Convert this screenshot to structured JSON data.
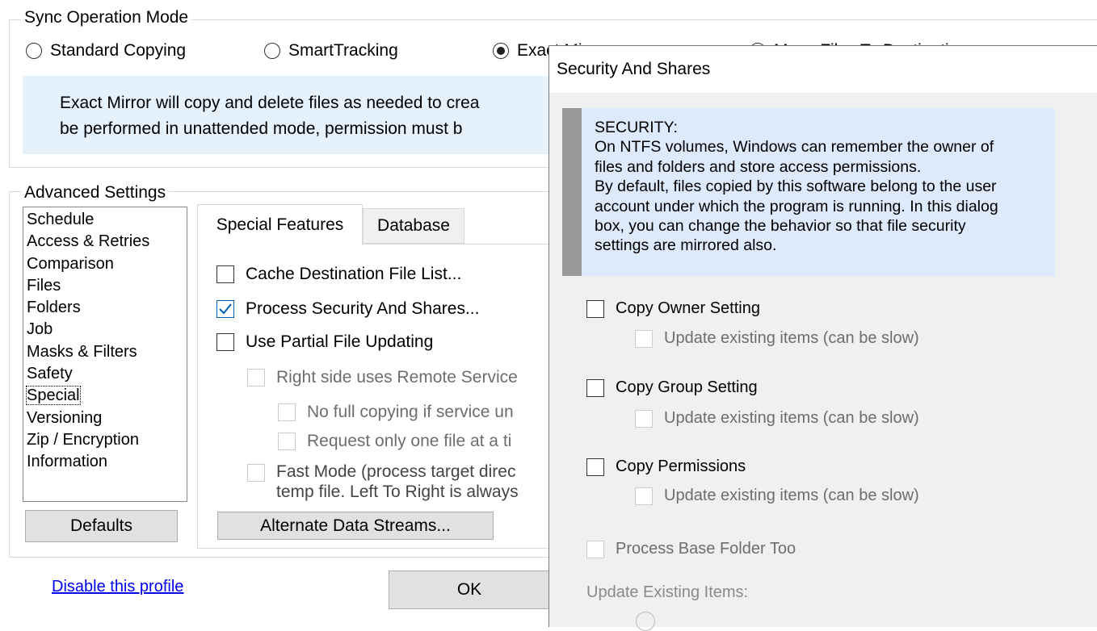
{
  "sync_mode": {
    "title": "Sync Operation Mode",
    "options": [
      {
        "label": "Standard Copying",
        "selected": false
      },
      {
        "label": "SmartTracking",
        "selected": false
      },
      {
        "label": "Exact Mirror",
        "selected": true
      },
      {
        "label": "Move Files To Destination",
        "selected": false
      }
    ],
    "description_line1": "Exact Mirror will copy and delete files as needed to crea",
    "description_line2": "be performed in unattended mode, permission must b"
  },
  "advanced": {
    "title": "Advanced Settings",
    "list_items": [
      "Schedule",
      "Access & Retries",
      "Comparison",
      "Files",
      "Folders",
      "Job",
      "Masks & Filters",
      "Safety",
      "Special",
      "Versioning",
      "Zip / Encryption",
      "Information"
    ],
    "selected_item": "Special",
    "defaults_button": "Defaults",
    "tabs": [
      "Special Features",
      "Database"
    ],
    "active_tab": "Special Features",
    "options": {
      "cache_dest": {
        "label": "Cache Destination File List...",
        "checked": false
      },
      "process_security": {
        "label": "Process Security And Shares...",
        "checked": true
      },
      "partial_update": {
        "label": "Use Partial File Updating",
        "checked": false
      },
      "remote_service": {
        "label": "Right side uses Remote Service",
        "checked": false
      },
      "no_full_copy": {
        "label": "No full copying if service un",
        "checked": false
      },
      "one_file": {
        "label": "Request only one file at a ti",
        "checked": false
      },
      "fast_mode_line1": "Fast Mode (process target direc",
      "fast_mode_line2": "temp file. Left To Right is always"
    },
    "ads_button": "Alternate Data Streams..."
  },
  "footer": {
    "disable_link": "Disable this profile",
    "ok_button": "OK"
  },
  "dialog": {
    "title": "Security And Shares",
    "info_text": "SECURITY:\nOn NTFS volumes, Windows can remember the owner of\nfiles and folders and store access permissions.\nBy default, files copied by this software belong to the user\naccount under which the program is running. In this dialog\nbox, you can change the behavior so that file security\nsettings are mirrored also.",
    "copy_owner": "Copy Owner Setting",
    "copy_group": "Copy Group Setting",
    "copy_permissions": "Copy Permissions",
    "update_existing": "Update existing items (can be slow)",
    "process_base": "Process Base Folder Too",
    "update_existing_items_label": "Update Existing Items:"
  },
  "colors": {
    "info_bg": "#e5f1fb",
    "dialog_info_bg": "#ddeafc",
    "checkbox_accent": "#005fb8",
    "link": "#0000ee"
  }
}
